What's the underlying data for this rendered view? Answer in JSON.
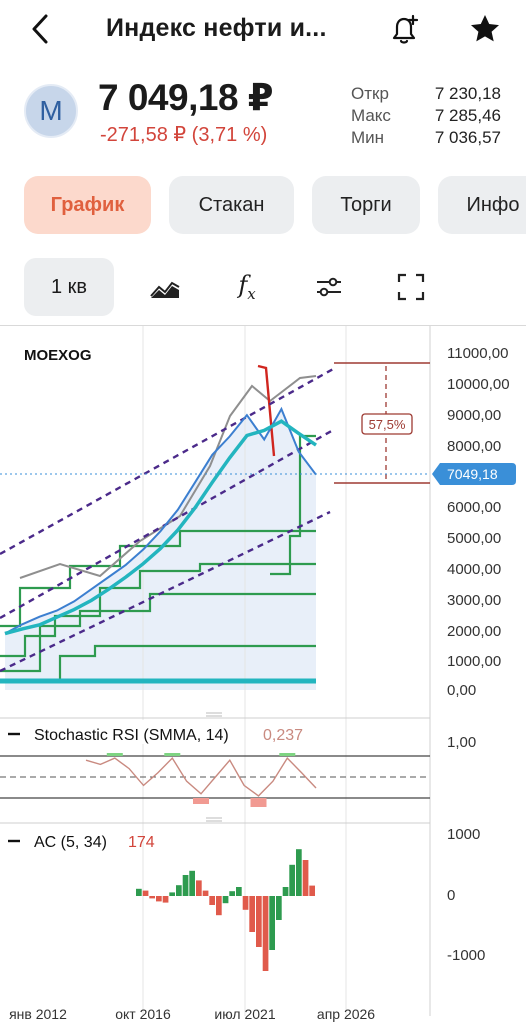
{
  "header": {
    "title": "Индекс нефти и...",
    "back_icon": "chevron-left-icon",
    "alert_icon": "bell-plus-icon",
    "favorite_icon": "star-icon"
  },
  "instrument": {
    "avatar_letter": "M",
    "price": "7 049,18 ₽",
    "change": "-271,58 ₽ (3,71 %)",
    "stats": [
      {
        "label": "Откр",
        "value": "7 230,18"
      },
      {
        "label": "Макс",
        "value": "7 285,46"
      },
      {
        "label": "Мин",
        "value": "7 036,57"
      }
    ]
  },
  "tabs": [
    {
      "label": "График",
      "active": true
    },
    {
      "label": "Стакан",
      "active": false
    },
    {
      "label": "Торги",
      "active": false
    },
    {
      "label": "Инфо",
      "active": false
    }
  ],
  "toolbar": {
    "period": "1 кв",
    "fx_label": "f",
    "fx_sub": "x"
  },
  "chart": {
    "symbol": "MOEXOG",
    "price_tag": "7049,18",
    "range_pct": "57,5%",
    "y_labels": [
      "11000,00",
      "10000,00",
      "9000,00",
      "8000,00",
      "6000,00",
      "5000,00",
      "4000,00",
      "3000,00",
      "2000,00",
      "1000,00",
      "0,00"
    ],
    "x_labels": [
      "янв 2012",
      "окт 2016",
      "июл 2021",
      "апр 2026"
    ],
    "colors": {
      "accent": "#e0603e",
      "up": "#2e9b4f",
      "down": "#e05a4b",
      "tag": "#3a8fd8"
    }
  },
  "stoch": {
    "name": "Stochastic RSI (SMMA, 14)",
    "value": "0,237",
    "y_label": "1,00"
  },
  "ac": {
    "name": "AC (5, 34)",
    "value": "174",
    "y_labels": [
      "1000",
      "0",
      "-1000"
    ]
  },
  "chart_data": [
    {
      "type": "line",
      "title": "MOEXOG",
      "x_ticks": [
        "янв 2012",
        "окт 2016",
        "июл 2021",
        "апр 2026"
      ],
      "ylim": [
        0,
        11000
      ],
      "series": [
        {
          "values": [
            1850,
            2150,
            2400,
            2600,
            2900,
            3300,
            3700,
            4100,
            4600,
            5200,
            5900,
            6800,
            7700,
            8300,
            9000,
            8200,
            9200,
            7800,
            7049
          ]
        }
      ]
    },
    {
      "type": "line",
      "title": "Stochastic RSI (SMMA, 14)",
      "ylim": [
        0,
        1
      ],
      "series": [
        {
          "values": [
            0.9,
            0.8,
            0.95,
            0.7,
            0.3,
            0.6,
            0.95,
            0.4,
            0.1,
            0.5,
            0.9,
            0.3,
            0.05,
            0.4,
            0.95,
            0.6,
            0.237
          ]
        }
      ]
    },
    {
      "type": "bar",
      "title": "AC (5, 34)",
      "ylim": [
        -1000,
        1000
      ],
      "values": [
        120,
        90,
        -40,
        -90,
        -110,
        60,
        180,
        350,
        420,
        260,
        90,
        -150,
        -320,
        -120,
        80,
        150,
        -230,
        -600,
        -850,
        -1250,
        -900,
        -400,
        150,
        520,
        780,
        600,
        174
      ]
    }
  ]
}
